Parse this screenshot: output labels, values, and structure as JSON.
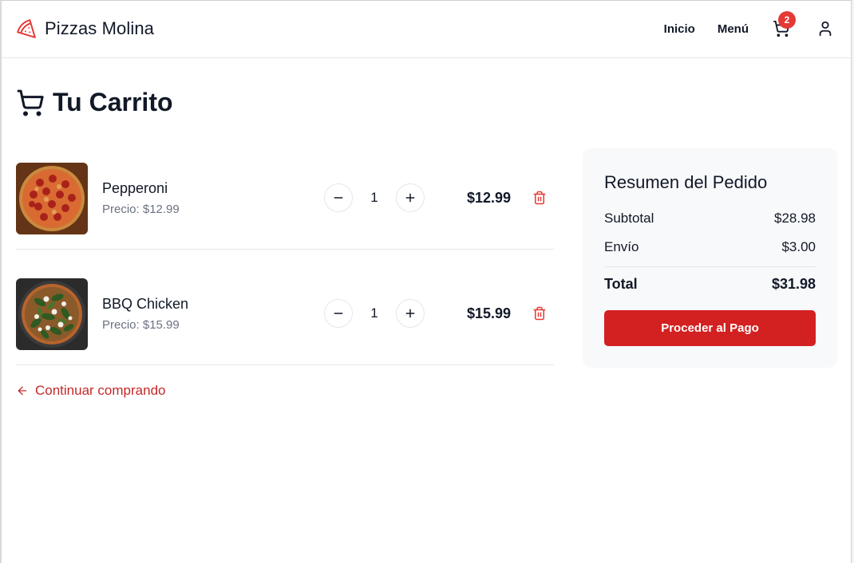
{
  "brand": {
    "name": "Pizzas Molina",
    "icon": "pizza-slice-icon",
    "color": "#e53935"
  },
  "nav": {
    "links": [
      "Inicio",
      "Menú"
    ],
    "cart_count": "2",
    "cart_icon": "cart-icon",
    "user_icon": "user-icon"
  },
  "page": {
    "title": "Tu Carrito",
    "title_icon": "cart-icon"
  },
  "cart": {
    "items": [
      {
        "name": "Pepperoni",
        "price_label": "Precio: $12.99",
        "quantity": "1",
        "line_total": "$12.99",
        "image": "pepperoni-pizza-photo"
      },
      {
        "name": "BBQ Chicken",
        "price_label": "Precio: $15.99",
        "quantity": "1",
        "line_total": "$15.99",
        "image": "bbq-chicken-pizza-photo"
      }
    ],
    "continue_label": "Continuar comprando"
  },
  "summary": {
    "title": "Resumen del Pedido",
    "subtotal_label": "Subtotal",
    "subtotal_value": "$28.98",
    "shipping_label": "Envío",
    "shipping_value": "$3.00",
    "total_label": "Total",
    "total_value": "$31.98",
    "checkout_label": "Proceder al Pago"
  },
  "colors": {
    "accent": "#d32020",
    "badge": "#e53935",
    "muted_text": "#6b7280",
    "summary_bg": "#f8f9fa"
  }
}
